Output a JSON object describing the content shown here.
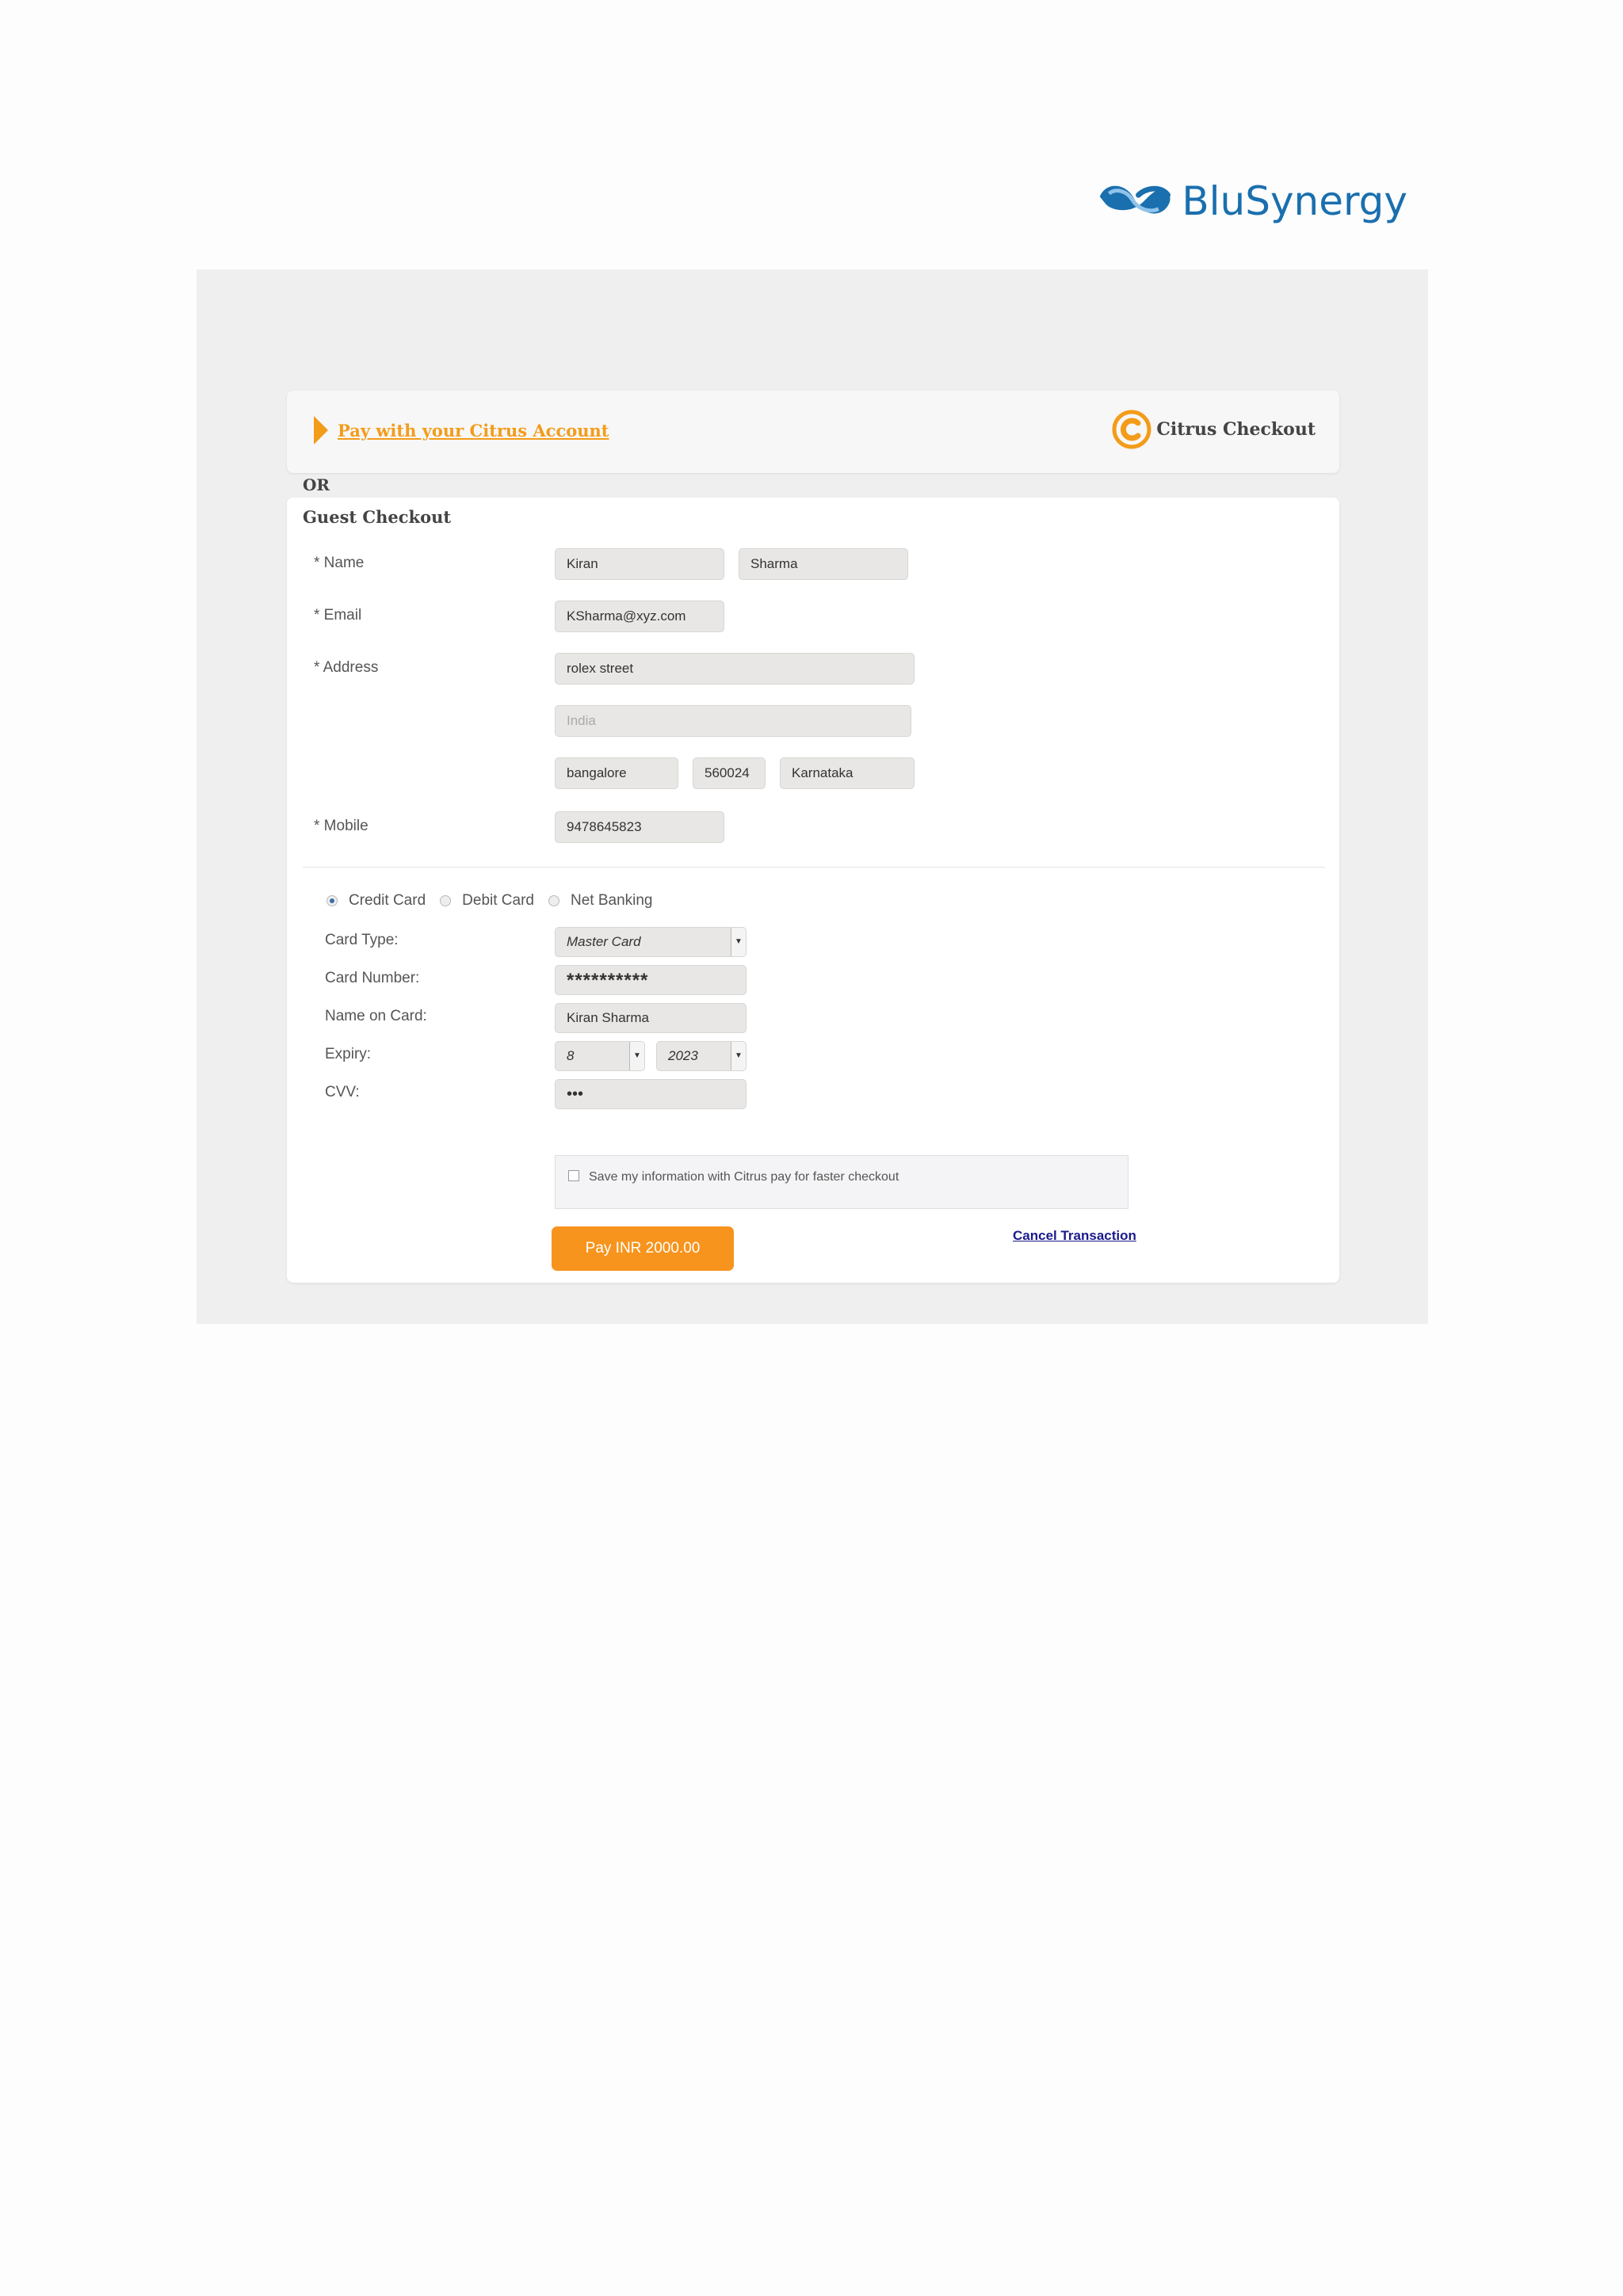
{
  "brand": {
    "name": "BluSynergy"
  },
  "citrus": {
    "pay_link": "Pay with your Citrus Account",
    "brand_text": "Citrus Checkout",
    "accent_color": "#f39c1a"
  },
  "or_label": "OR",
  "guest": {
    "title": "Guest Checkout",
    "labels": {
      "name": "* Name",
      "email": "* Email",
      "address": "* Address",
      "mobile": "* Mobile"
    },
    "values": {
      "first_name": "Kiran",
      "last_name": "Sharma",
      "email": "KSharma@xyz.com",
      "street": "rolex street",
      "country_placeholder": "India",
      "city": "bangalore",
      "zip": "560024",
      "state": "Karnataka",
      "mobile": "9478645823"
    }
  },
  "payment": {
    "methods": [
      {
        "label": "Credit Card",
        "checked": true
      },
      {
        "label": "Debit Card",
        "checked": false
      },
      {
        "label": "Net Banking",
        "checked": false
      }
    ],
    "labels": {
      "card_type": "Card Type:",
      "card_number": "Card Number:",
      "name_on_card": "Name on Card:",
      "expiry": "Expiry:",
      "cvv": "CVV:"
    },
    "values": {
      "card_type": "Master Card",
      "card_number": "**********",
      "name_on_card": "Kiran Sharma",
      "expiry_month": "8",
      "expiry_year": "2023",
      "cvv": "•••"
    },
    "save_text": "Save my information with Citrus pay for faster checkout",
    "pay_button": "Pay INR 2000.00",
    "cancel_link": "Cancel Transaction"
  }
}
